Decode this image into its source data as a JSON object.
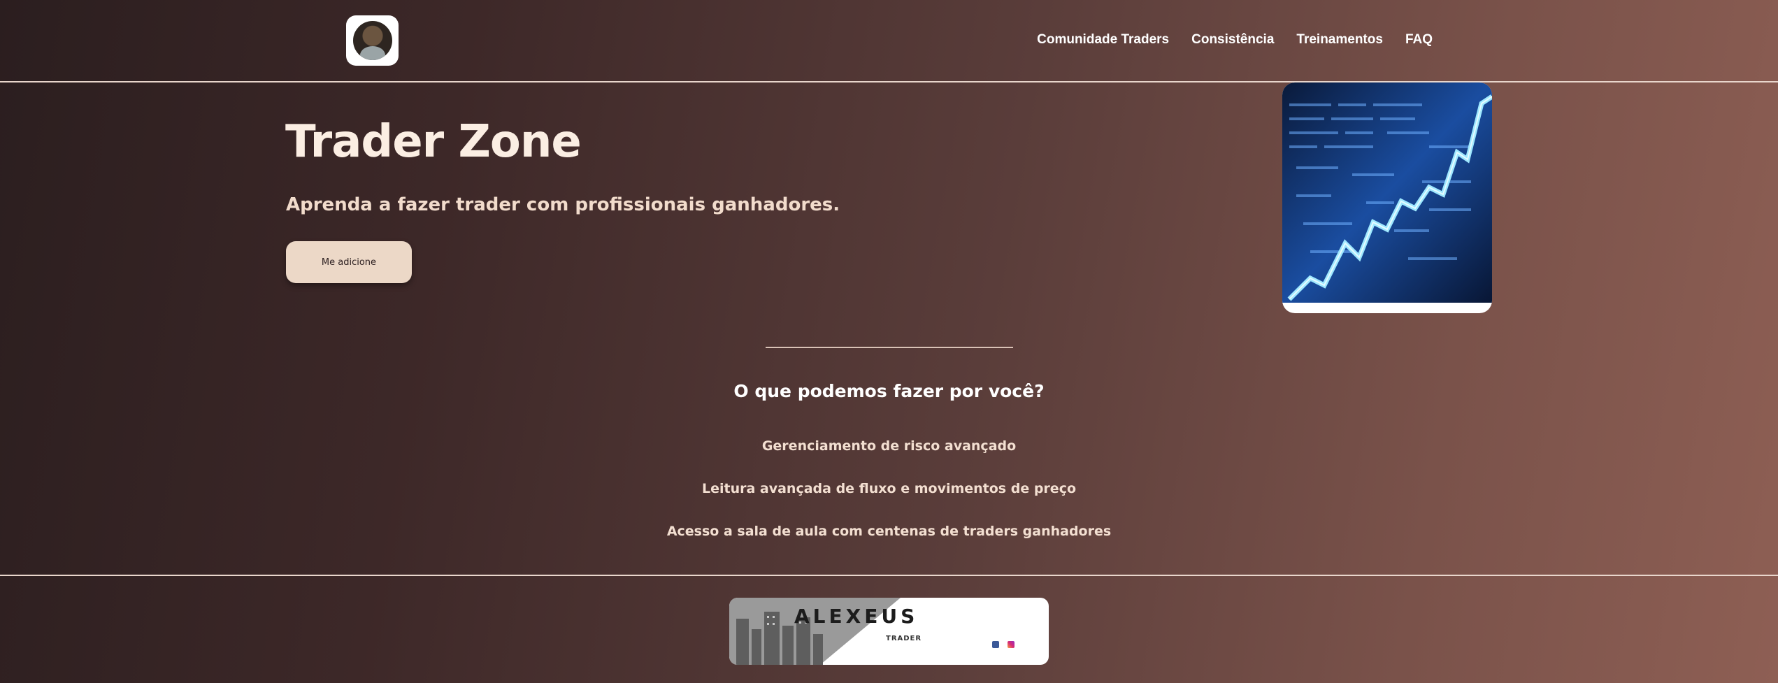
{
  "header": {
    "logo_icon": "avatar-photo",
    "nav": [
      {
        "label": "Comunidade Traders"
      },
      {
        "label": "Consistência"
      },
      {
        "label": "Treinamentos"
      },
      {
        "label": "FAQ"
      }
    ]
  },
  "hero": {
    "title": "Trader Zone",
    "subtitle": "Aprenda a fazer trader com profissionais ganhadores.",
    "cta_label": "Me adicione",
    "image_icon": "stock-market-chart-image"
  },
  "services": {
    "title": "O que podemos fazer por você?",
    "items": [
      "Gerenciamento de risco avançado",
      "Leitura avançada de fluxo e movimentos de preço",
      "Acesso a sala de aula com centenas de traders ganhadores"
    ]
  },
  "footer": {
    "brand": "ALEXEUS",
    "brand_sub": "TRADER",
    "social_icons": [
      "facebook-icon",
      "instagram-icon"
    ]
  },
  "colors": {
    "bg_start": "#2b1e1f",
    "bg_end": "#8e5f54",
    "cta_bg": "#ecd8c7",
    "text_light": "#f7e6d9"
  }
}
